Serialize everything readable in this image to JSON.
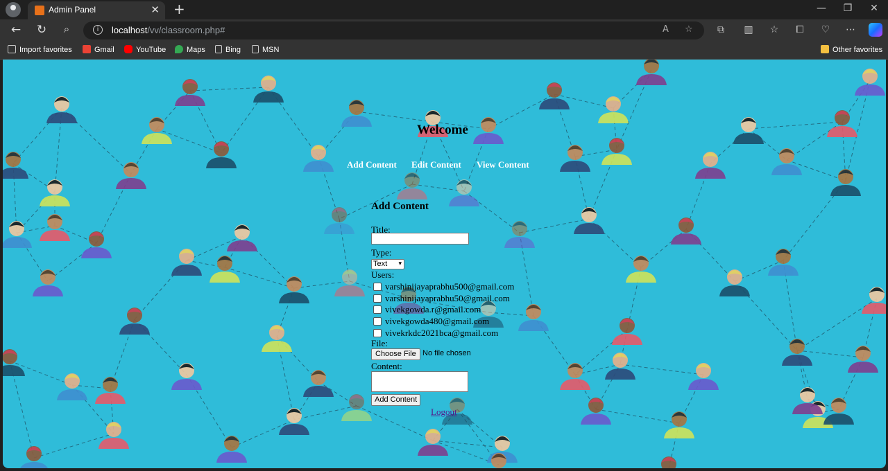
{
  "browser": {
    "tab_title": "Admin Panel",
    "url_host": "localhost",
    "url_path": "/vv/classroom.php#",
    "bookmarks": [
      "Import favorites",
      "Gmail",
      "YouTube",
      "Maps",
      "Bing",
      "MSN"
    ],
    "other_favorites": "Other favorites"
  },
  "page": {
    "heading": "Welcome",
    "menu": [
      "Add Content",
      "Edit Content",
      "View Content"
    ],
    "form": {
      "title": "Add Content",
      "title_label": "Title:",
      "type_label": "Type:",
      "type_selected": "Text",
      "users_label": "Users:",
      "users": [
        "varshinijayaprabhu500@gmail.com",
        "varshinijayaprabhu50@gmail.com",
        "vivekgowda.r@gmail.com",
        "vivekgowda480@gmail.com",
        "vivekrkdc2021bca@gmail.com"
      ],
      "file_label": "File:",
      "file_button": "Choose File",
      "file_status": "No file chosen",
      "content_label": "Content:",
      "submit": "Add Content"
    },
    "logout": "Logout"
  }
}
